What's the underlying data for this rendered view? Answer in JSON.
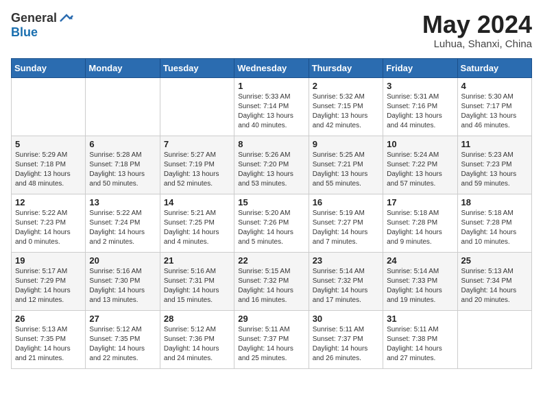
{
  "logo": {
    "general": "General",
    "blue": "Blue"
  },
  "title": {
    "month_year": "May 2024",
    "location": "Luhua, Shanxi, China"
  },
  "headers": [
    "Sunday",
    "Monday",
    "Tuesday",
    "Wednesday",
    "Thursday",
    "Friday",
    "Saturday"
  ],
  "weeks": [
    [
      {
        "day": "",
        "info": ""
      },
      {
        "day": "",
        "info": ""
      },
      {
        "day": "",
        "info": ""
      },
      {
        "day": "1",
        "info": "Sunrise: 5:33 AM\nSunset: 7:14 PM\nDaylight: 13 hours\nand 40 minutes."
      },
      {
        "day": "2",
        "info": "Sunrise: 5:32 AM\nSunset: 7:15 PM\nDaylight: 13 hours\nand 42 minutes."
      },
      {
        "day": "3",
        "info": "Sunrise: 5:31 AM\nSunset: 7:16 PM\nDaylight: 13 hours\nand 44 minutes."
      },
      {
        "day": "4",
        "info": "Sunrise: 5:30 AM\nSunset: 7:17 PM\nDaylight: 13 hours\nand 46 minutes."
      }
    ],
    [
      {
        "day": "5",
        "info": "Sunrise: 5:29 AM\nSunset: 7:18 PM\nDaylight: 13 hours\nand 48 minutes."
      },
      {
        "day": "6",
        "info": "Sunrise: 5:28 AM\nSunset: 7:18 PM\nDaylight: 13 hours\nand 50 minutes."
      },
      {
        "day": "7",
        "info": "Sunrise: 5:27 AM\nSunset: 7:19 PM\nDaylight: 13 hours\nand 52 minutes."
      },
      {
        "day": "8",
        "info": "Sunrise: 5:26 AM\nSunset: 7:20 PM\nDaylight: 13 hours\nand 53 minutes."
      },
      {
        "day": "9",
        "info": "Sunrise: 5:25 AM\nSunset: 7:21 PM\nDaylight: 13 hours\nand 55 minutes."
      },
      {
        "day": "10",
        "info": "Sunrise: 5:24 AM\nSunset: 7:22 PM\nDaylight: 13 hours\nand 57 minutes."
      },
      {
        "day": "11",
        "info": "Sunrise: 5:23 AM\nSunset: 7:23 PM\nDaylight: 13 hours\nand 59 minutes."
      }
    ],
    [
      {
        "day": "12",
        "info": "Sunrise: 5:22 AM\nSunset: 7:23 PM\nDaylight: 14 hours\nand 0 minutes."
      },
      {
        "day": "13",
        "info": "Sunrise: 5:22 AM\nSunset: 7:24 PM\nDaylight: 14 hours\nand 2 minutes."
      },
      {
        "day": "14",
        "info": "Sunrise: 5:21 AM\nSunset: 7:25 PM\nDaylight: 14 hours\nand 4 minutes."
      },
      {
        "day": "15",
        "info": "Sunrise: 5:20 AM\nSunset: 7:26 PM\nDaylight: 14 hours\nand 5 minutes."
      },
      {
        "day": "16",
        "info": "Sunrise: 5:19 AM\nSunset: 7:27 PM\nDaylight: 14 hours\nand 7 minutes."
      },
      {
        "day": "17",
        "info": "Sunrise: 5:18 AM\nSunset: 7:28 PM\nDaylight: 14 hours\nand 9 minutes."
      },
      {
        "day": "18",
        "info": "Sunrise: 5:18 AM\nSunset: 7:28 PM\nDaylight: 14 hours\nand 10 minutes."
      }
    ],
    [
      {
        "day": "19",
        "info": "Sunrise: 5:17 AM\nSunset: 7:29 PM\nDaylight: 14 hours\nand 12 minutes."
      },
      {
        "day": "20",
        "info": "Sunrise: 5:16 AM\nSunset: 7:30 PM\nDaylight: 14 hours\nand 13 minutes."
      },
      {
        "day": "21",
        "info": "Sunrise: 5:16 AM\nSunset: 7:31 PM\nDaylight: 14 hours\nand 15 minutes."
      },
      {
        "day": "22",
        "info": "Sunrise: 5:15 AM\nSunset: 7:32 PM\nDaylight: 14 hours\nand 16 minutes."
      },
      {
        "day": "23",
        "info": "Sunrise: 5:14 AM\nSunset: 7:32 PM\nDaylight: 14 hours\nand 17 minutes."
      },
      {
        "day": "24",
        "info": "Sunrise: 5:14 AM\nSunset: 7:33 PM\nDaylight: 14 hours\nand 19 minutes."
      },
      {
        "day": "25",
        "info": "Sunrise: 5:13 AM\nSunset: 7:34 PM\nDaylight: 14 hours\nand 20 minutes."
      }
    ],
    [
      {
        "day": "26",
        "info": "Sunrise: 5:13 AM\nSunset: 7:35 PM\nDaylight: 14 hours\nand 21 minutes."
      },
      {
        "day": "27",
        "info": "Sunrise: 5:12 AM\nSunset: 7:35 PM\nDaylight: 14 hours\nand 22 minutes."
      },
      {
        "day": "28",
        "info": "Sunrise: 5:12 AM\nSunset: 7:36 PM\nDaylight: 14 hours\nand 24 minutes."
      },
      {
        "day": "29",
        "info": "Sunrise: 5:11 AM\nSunset: 7:37 PM\nDaylight: 14 hours\nand 25 minutes."
      },
      {
        "day": "30",
        "info": "Sunrise: 5:11 AM\nSunset: 7:37 PM\nDaylight: 14 hours\nand 26 minutes."
      },
      {
        "day": "31",
        "info": "Sunrise: 5:11 AM\nSunset: 7:38 PM\nDaylight: 14 hours\nand 27 minutes."
      },
      {
        "day": "",
        "info": ""
      }
    ]
  ]
}
